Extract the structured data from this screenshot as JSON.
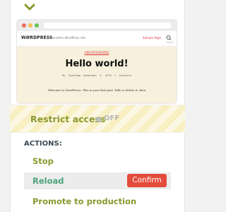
{
  "preview": {
    "site_logo": "WØRDPRESS",
    "site_tagline": "Just another WordPress site",
    "menu_link": "Sample Page",
    "search_label": "Search",
    "category": "UNCATEGORIZED",
    "post_title": "Hello world!",
    "post_meta": "By ScanPage   November 3, 2016   1 Comment",
    "post_excerpt": "Welcome to WordPress. This is your first post. Edit or delete it, then"
  },
  "restrict": {
    "label": "Restrict access",
    "toggle_state": "OFF"
  },
  "actions": {
    "heading": "ACTIONS:",
    "items": [
      {
        "label": "Stop"
      },
      {
        "label": "Reload"
      },
      {
        "label": "Promote to production"
      }
    ],
    "confirm_label": "Confirm"
  },
  "colors": {
    "accent_green": "#879a2d",
    "reload_green": "#4da27b",
    "confirm_red": "#e34b3b",
    "heading": "#3a4a55"
  }
}
